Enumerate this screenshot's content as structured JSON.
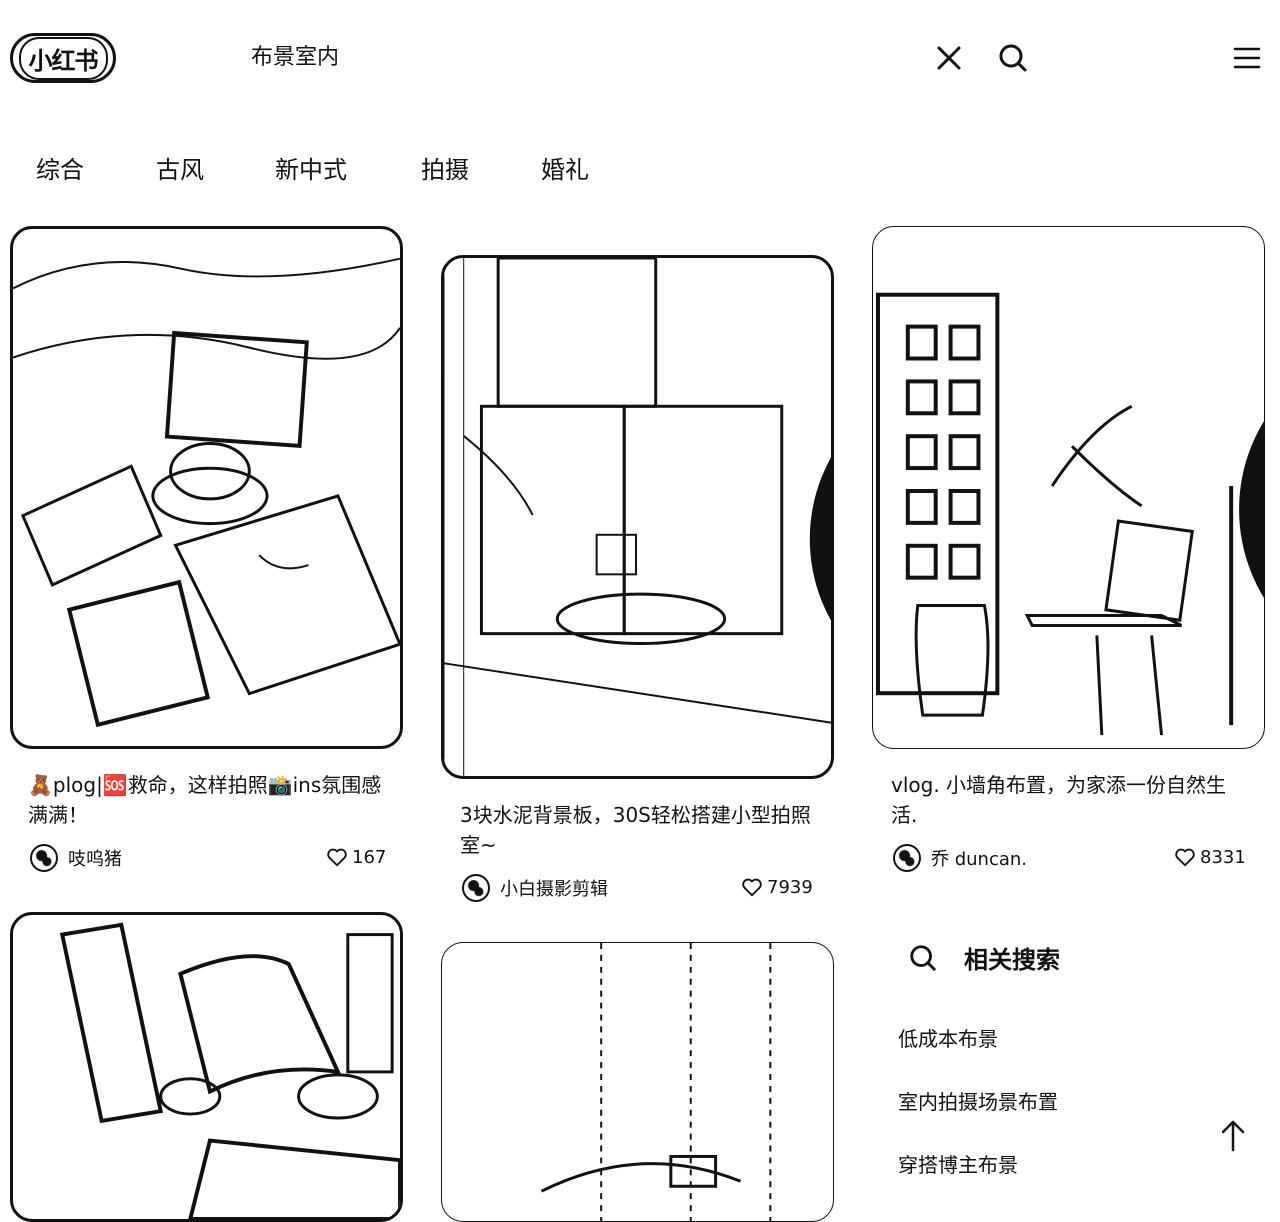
{
  "header": {
    "logo": "小红书",
    "search_query": "布景室内"
  },
  "tabs": [
    "综合",
    "古风",
    "新中式",
    "拍摄",
    "婚礼"
  ],
  "cards": [
    {
      "title": "🧸plog|🆘救命，这样拍照📸ins氛围感满满！",
      "author": "吱呜猪",
      "likes": "167"
    },
    {
      "title": "3块水泥背景板，30S轻松搭建小型拍照室~",
      "author": "小白摄影剪辑",
      "likes": "7939"
    },
    {
      "title": "vlog. 小墙角布置，为家添一份自然生活.",
      "author": "乔 duncan.",
      "likes": "8331"
    }
  ],
  "related": {
    "heading": "相关搜索",
    "items": [
      "低成本布景",
      "室内拍摄场景布置",
      "穿搭博主布景"
    ]
  }
}
